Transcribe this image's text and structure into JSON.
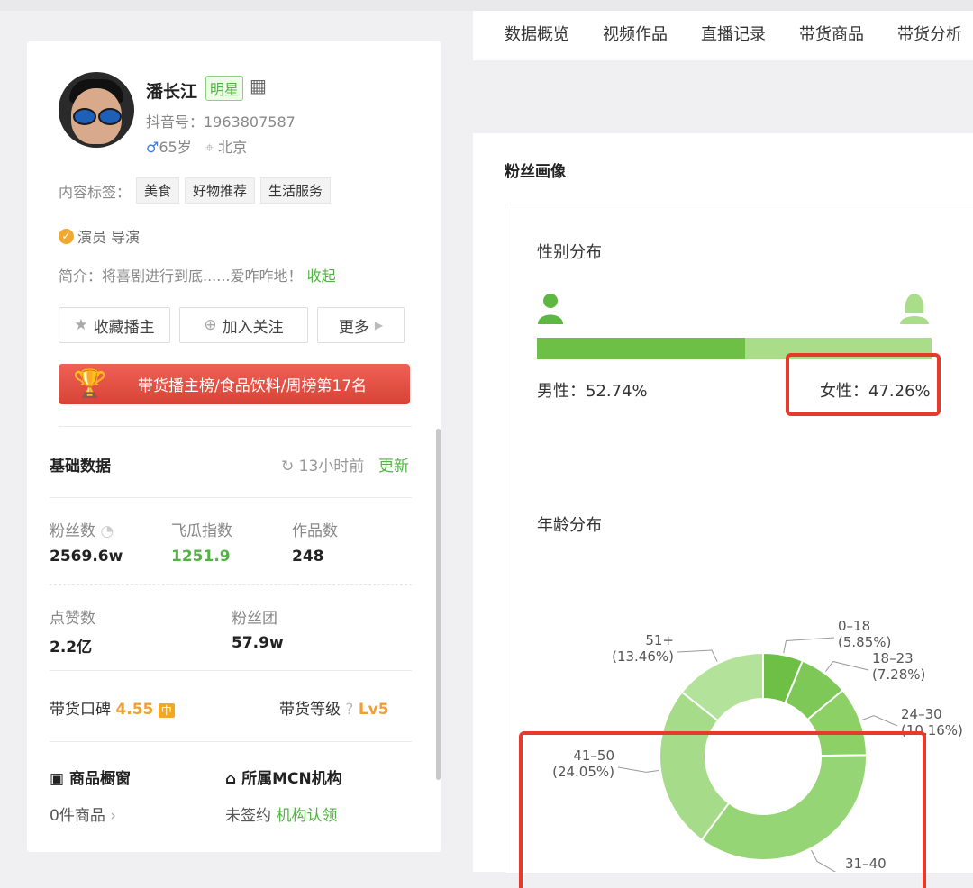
{
  "profile": {
    "name": "潘长江",
    "badge": "明星",
    "douyin_id": "抖音号：1963807587",
    "age": "65岁",
    "location": "北京",
    "tags_label": "内容标签：",
    "tags": [
      "美食",
      "好物推荐",
      "生活服务"
    ],
    "verified": "演员 导演",
    "intro_text": "简介：将喜剧进行到底......爱咋咋地！",
    "intro_collapse": "收起",
    "buttons": {
      "favorite": "收藏播主",
      "follow": "加入关注",
      "more": "更多"
    },
    "rank": "带货播主榜/食品饮料/周榜第17名"
  },
  "basic": {
    "title": "基础数据",
    "updated": "13小时前",
    "update_link": "更新",
    "fans_label": "粉丝数",
    "fans_value": "2569.6w",
    "index_label": "飞瓜指数",
    "index_value": "1251.9",
    "works_label": "作品数",
    "works_value": "248",
    "likes_label": "点赞数",
    "likes_value": "2.2亿",
    "fanclub_label": "粉丝团",
    "fanclub_value": "57.9w",
    "rep_label": "带货口碑",
    "rep_value": "4.55",
    "rep_badge": "中",
    "level_label": "带货等级",
    "level_value": "Lv5",
    "shop_label": "商品橱窗",
    "shop_value": "0件商品",
    "mcn_label": "所属MCN机构",
    "mcn_value": "未签约",
    "mcn_link": "机构认领"
  },
  "nav": [
    "数据概览",
    "视频作品",
    "直播记录",
    "带货商品",
    "带货分析"
  ],
  "fans_portrait": {
    "title": "粉丝画像",
    "gender_title": "性别分布",
    "male_label": "男性：52.74%",
    "female_label": "女性：47.26%",
    "age_title": "年龄分布"
  },
  "chart_data": [
    {
      "type": "bar",
      "title": "性别分布",
      "categories": [
        "男性",
        "女性"
      ],
      "values": [
        52.74,
        47.26
      ],
      "unit": "%",
      "colors": [
        "#6dbf45",
        "#a9dd8a"
      ]
    },
    {
      "type": "pie",
      "title": "年龄分布",
      "categories": [
        "0-18",
        "18-23",
        "24-30",
        "31-40",
        "41-50",
        "51+"
      ],
      "values": [
        5.85,
        7.28,
        10.16,
        33.2,
        24.05,
        13.46
      ],
      "value_labels": [
        "(5.85%)",
        "(7.28%)",
        "(10.16%)",
        "",
        "(24.05%)",
        "(13.46%)"
      ],
      "visible_names": [
        "0–18",
        "18–23",
        "24–30",
        "31–40",
        "41–50",
        "51+"
      ],
      "colors": [
        "#6dbf45",
        "#7dc857",
        "#8cd066",
        "#96d575",
        "#a6dc89",
        "#b3e29a"
      ]
    }
  ],
  "colors": {
    "accent": "#52b243",
    "highlight": "#e53a2c",
    "rank": "#e0493d"
  }
}
